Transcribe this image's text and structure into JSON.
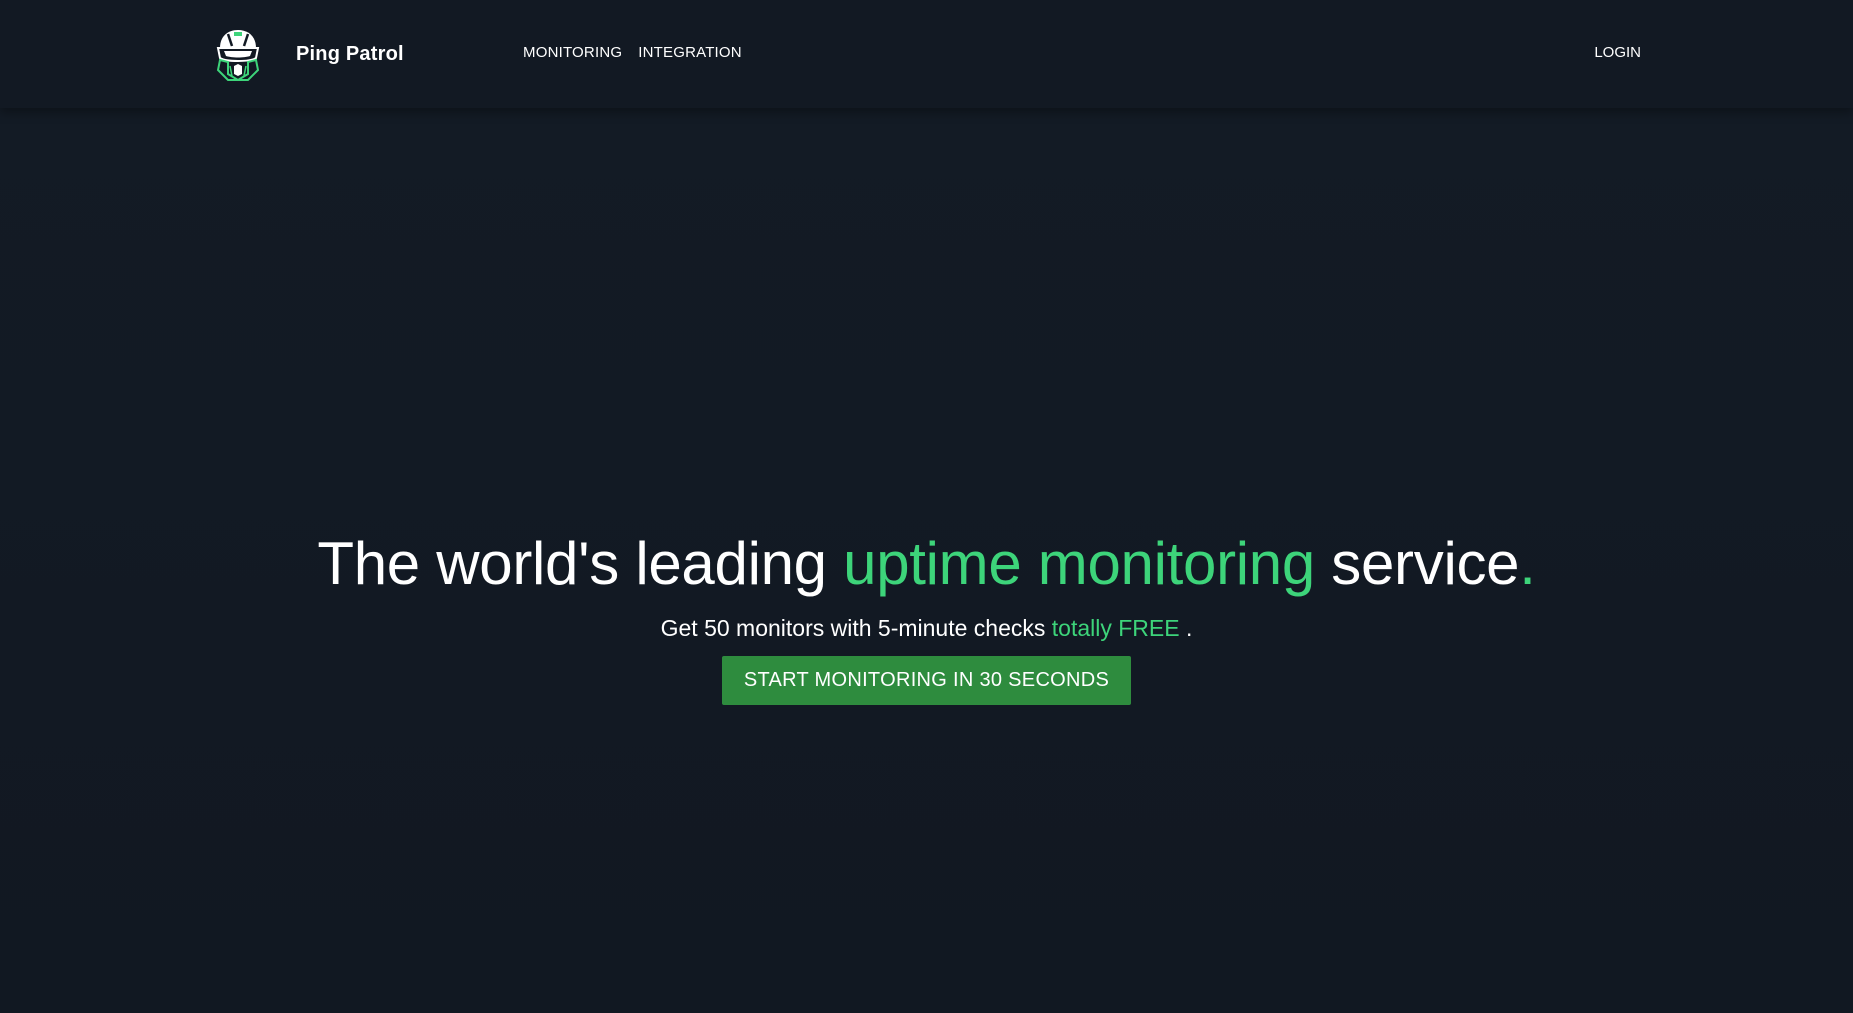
{
  "brand": {
    "name": "Ping Patrol",
    "logo_icon": "helmet-icon",
    "accent_color": "#3dd47a"
  },
  "nav": {
    "items": [
      {
        "label": "MONITORING"
      },
      {
        "label": "INTEGRATION"
      }
    ],
    "login_label": "LOGIN"
  },
  "hero": {
    "headline_part1": "The world's leading ",
    "headline_accent": "uptime monitoring",
    "headline_part2": " service",
    "headline_period": ".",
    "subline_part1": "Get 50 monitors with 5-minute checks ",
    "subline_accent": "totally FREE",
    "subline_part2": " .",
    "cta_label": "START MONITORING IN 30 SECONDS",
    "cta_color": "#2e8c3e"
  },
  "colors": {
    "background": "#121923",
    "text": "#ffffff"
  }
}
